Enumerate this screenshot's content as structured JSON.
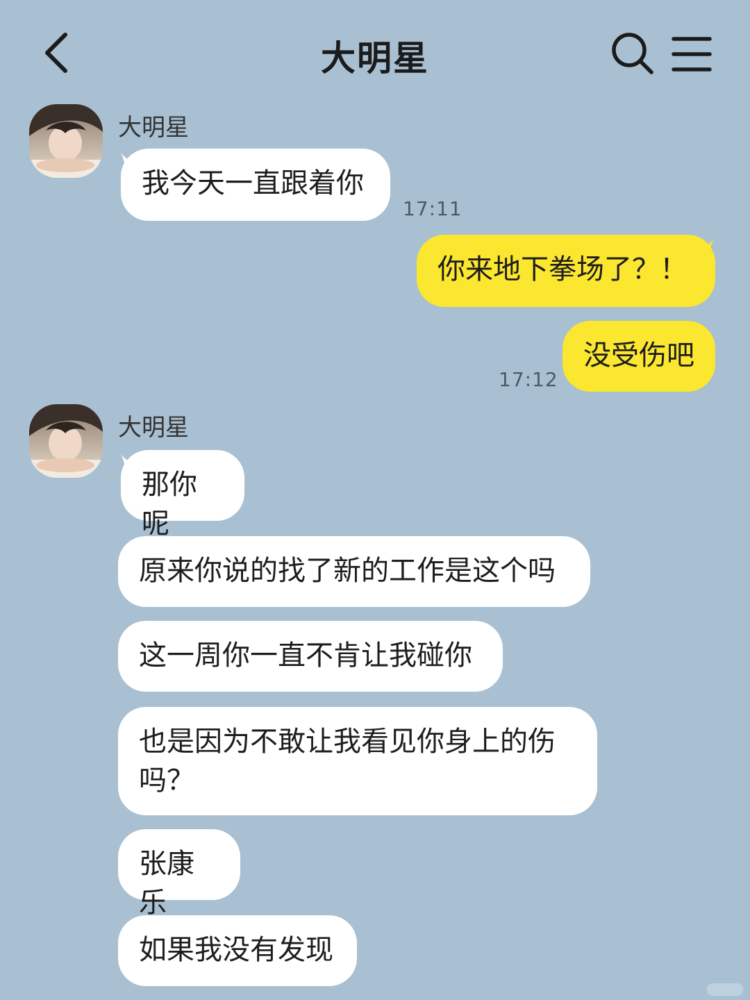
{
  "header": {
    "title": "大明星",
    "back_icon": "chevron-left-icon",
    "search_icon": "search-icon",
    "menu_icon": "menu-icon"
  },
  "colors": {
    "background": "#a9c0d2",
    "incoming_bubble": "#ffffff",
    "outgoing_bubble": "#fbe630"
  },
  "groups": [
    {
      "sender": "大明星",
      "messages": [
        {
          "text": "我今天一直跟着你",
          "time": "17:11"
        }
      ]
    },
    {
      "sender": "",
      "messages": [
        {
          "text": "你来地下拳场了？！"
        },
        {
          "text": "没受伤吧",
          "time": "17:12"
        }
      ]
    },
    {
      "sender": "大明星",
      "messages": [
        {
          "text": "那你呢"
        },
        {
          "text": "原来你说的找了新的工作是这个吗"
        },
        {
          "text": "这一周你一直不肯让我碰你"
        },
        {
          "text": "也是因为不敢让我看见你身上的伤\n吗？"
        },
        {
          "text": "张康乐"
        },
        {
          "text": "如果我没有发现"
        }
      ]
    }
  ]
}
